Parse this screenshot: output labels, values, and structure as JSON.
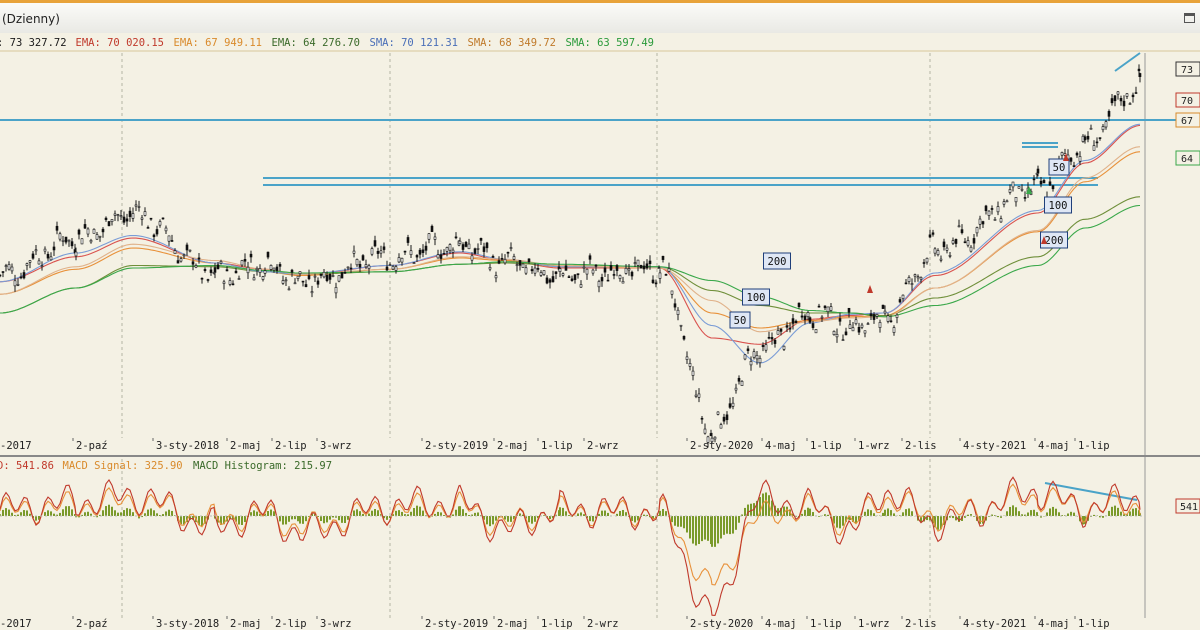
{
  "window": {
    "title": "(Dzienny)"
  },
  "colors": {
    "up": "#1a1a1a",
    "ema70": "#d9534f",
    "ema67": "#e8913a",
    "ema64": "#5b7fc6",
    "sma70": "#7a9cd6",
    "sma68": "#e0b28a",
    "sma63": "#3aa84a",
    "level": "#4aa3c8",
    "macd": "#c0392b",
    "signal": "#e8913a",
    "hist": "#7a9a2a",
    "grid": "#b5b5a5"
  },
  "main_legend": [
    {
      "text": ": 73 327.72",
      "color": "#1a1a1a"
    },
    {
      "text": "EMA: 70 020.15",
      "color": "#c0392b"
    },
    {
      "text": "EMA: 67 949.11",
      "color": "#d98a2b"
    },
    {
      "text": "EMA: 64 276.70",
      "color": "#3a6a2a"
    },
    {
      "text": "SMA: 70 121.31",
      "color": "#4a6fb8"
    },
    {
      "text": "SMA: 68 349.72",
      "color": "#c07a2a"
    },
    {
      "text": "SMA: 63 597.49",
      "color": "#2a9a3a"
    }
  ],
  "macd_legend": [
    {
      "text": "D: 541.86",
      "color": "#c0392b"
    },
    {
      "text": "MACD Signal: 325.90",
      "color": "#d98a2b"
    },
    {
      "text": "MACD Histogram: 215.97",
      "color": "#3a6a2a"
    }
  ],
  "chart_data": [
    {
      "type": "line",
      "subtype": "candlestick with moving averages",
      "title": "",
      "x_tick_labels": [
        "-2017",
        "2-paź",
        "3-sty-2018",
        "2-maj",
        "2-lip",
        "3-wrz",
        "2-sty-2019",
        "2-maj",
        "1-lip",
        "2-wrz",
        "2-sty-2020",
        "4-maj",
        "1-lip",
        "1-wrz",
        "2-lis",
        "4-sty-2021",
        "4-maj",
        "1-lip"
      ],
      "price_axis_labels": [
        "73",
        "70",
        "67",
        "64"
      ],
      "ylim": [
        45000,
        75000
      ],
      "grid": true,
      "legend_position": "top-left",
      "series": [
        {
          "name": "",
          "x": [
            "2017-07",
            "2017-10",
            "2018-01",
            "2018-05",
            "2018-07",
            "2018-09",
            "2019-01",
            "2019-05",
            "2019-07",
            "2019-09",
            "2020-01",
            "2020-03",
            "2020-05",
            "2020-07",
            "2020-09",
            "2020-11",
            "2021-01",
            "2021-05",
            "2021-07",
            "2021-09"
          ],
          "values": [
            58000,
            61000,
            63000,
            58000,
            59000,
            57500,
            59500,
            60500,
            59000,
            58000,
            58500,
            45500,
            52000,
            55000,
            54000,
            54500,
            60000,
            65000,
            68500,
            73300
          ]
        },
        {
          "name": "EMA",
          "values": [
            57500,
            59500,
            61000,
            59000,
            58500,
            58000,
            58800,
            59800,
            59200,
            58600,
            58600,
            53000,
            52500,
            54500,
            54800,
            55000,
            58000,
            63000,
            67000,
            70000
          ]
        },
        {
          "name": "EMA",
          "values": [
            56500,
            58500,
            60200,
            59000,
            58300,
            58000,
            58500,
            59400,
            59200,
            58700,
            58600,
            55000,
            53800,
            54400,
            54700,
            54800,
            57000,
            61500,
            65500,
            67900
          ]
        },
        {
          "name": "EMA",
          "values": [
            55000,
            57000,
            58800,
            58700,
            58300,
            58100,
            58300,
            58900,
            59000,
            58800,
            58700,
            56800,
            55600,
            55000,
            55000,
            54800,
            56200,
            59500,
            62500,
            64300
          ]
        },
        {
          "name": "SMA",
          "values": [
            57500,
            59800,
            61200,
            59000,
            58300,
            58100,
            58800,
            59900,
            59300,
            58700,
            58700,
            54000,
            51000,
            54200,
            54900,
            55000,
            58200,
            63200,
            67200,
            70100
          ]
        },
        {
          "name": "SMA",
          "values": [
            56500,
            58700,
            60500,
            59200,
            58500,
            58100,
            58500,
            59500,
            59300,
            58800,
            58600,
            56000,
            53500,
            54300,
            54600,
            54700,
            57000,
            61600,
            65800,
            68300
          ]
        },
        {
          "name": "SMA",
          "values": [
            55000,
            57000,
            58600,
            58800,
            58400,
            58200,
            58300,
            58900,
            59100,
            58900,
            58700,
            57600,
            56300,
            55200,
            55000,
            54700,
            55600,
            58800,
            61800,
            63600
          ]
        }
      ],
      "annotations": {
        "horizontal_levels": [
          69500,
          61500,
          60800
        ],
        "ma_badges": [
          "50",
          "100",
          "200",
          "50",
          "100",
          "200"
        ],
        "trend_line": "rising wedge top-right"
      }
    },
    {
      "type": "line",
      "subtype": "MACD",
      "x_tick_labels": [
        "-2017",
        "2-paź",
        "3-sty-2018",
        "2-maj",
        "2-lip",
        "3-wrz",
        "2-sty-2019",
        "2-maj",
        "1-lip",
        "2-wrz",
        "2-sty-2020",
        "4-maj",
        "1-lip",
        "1-wrz",
        "2-lis",
        "4-sty-2021",
        "4-maj",
        "1-lip"
      ],
      "axis_labels": [
        "541"
      ],
      "series": [
        {
          "name": "MACD",
          "values": [
            200,
            400,
            600,
            -300,
            100,
            -500,
            300,
            400,
            -400,
            200,
            100,
            -2900,
            500,
            300,
            -400,
            700,
            -200,
            700,
            200,
            541.86
          ]
        },
        {
          "name": "MACD Signal",
          "values": [
            150,
            300,
            450,
            -100,
            50,
            -350,
            200,
            300,
            -250,
            150,
            100,
            -2000,
            0,
            250,
            -200,
            500,
            0,
            550,
            250,
            325.9
          ]
        },
        {
          "name": "MACD Histogram",
          "values": [
            50,
            100,
            150,
            -200,
            50,
            -150,
            100,
            100,
            -150,
            50,
            0,
            -900,
            500,
            50,
            -200,
            200,
            -200,
            150,
            -50,
            215.97
          ]
        }
      ],
      "grid": true
    }
  ]
}
